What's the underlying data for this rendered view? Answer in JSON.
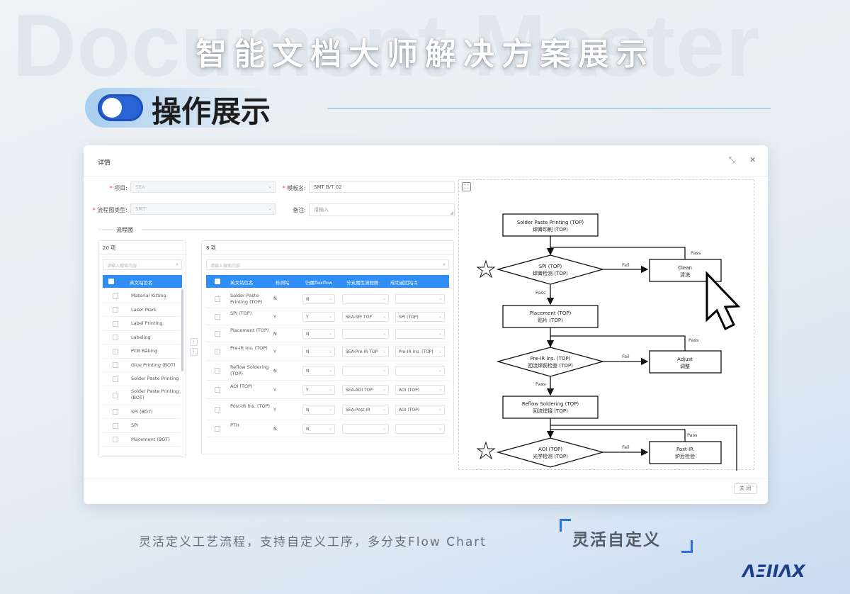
{
  "watermark": "Document Master",
  "page_title": "智能文档大师解决方案展示",
  "section": {
    "title": "操作展示"
  },
  "dialog": {
    "title": "详情",
    "form": {
      "project_label": "项目:",
      "project_value": "SEA",
      "template_label": "模板名:",
      "template_value": "SMT B/T 02",
      "flow_type_label": "流程图类型:",
      "flow_type_value": "SMT",
      "remark_label": "备注:",
      "remark_placeholder": "请输入"
    },
    "group_title": "流程图",
    "left_panel": {
      "count": "20 项",
      "search_placeholder": "请输入搜索内容",
      "header": "英文站位名",
      "items": [
        "Material Kitting",
        "Laser Mark",
        "Label Printing",
        "Labeling",
        "PCB Baking",
        "Glue Printing (BOT)",
        "Solder Paste Printing",
        "Solder Paste Printing (BOT)",
        "SPI (BOT)",
        "SPI",
        "Placement (BOT)"
      ]
    },
    "right_panel": {
      "count": "8 项",
      "search_placeholder": "请输入搜索内容",
      "columns": [
        "英文站位名",
        "检测站",
        "归属flexflow",
        "分支属性流程图",
        "成功返回站点"
      ],
      "rows": [
        {
          "name": "Solder Paste Printing (TOP)",
          "check": "N",
          "flex": "N",
          "branch": "",
          "ret": ""
        },
        {
          "name": "SPI (TOP)",
          "check": "Y",
          "flex": "Y",
          "branch": "SEA-SPI TOP",
          "ret": "SPI (TOP)"
        },
        {
          "name": "Placement (TOP)",
          "check": "N",
          "flex": "N",
          "branch": "",
          "ret": ""
        },
        {
          "name": "Pre-IR Ins. (TOP)",
          "check": "Y",
          "flex": "N",
          "branch": "SEA-Pre-IR TOP",
          "ret": "Pre-IR Ins. (TOP)"
        },
        {
          "name": "Reflow Soldering (TOP)",
          "check": "N",
          "flex": "N",
          "branch": "",
          "ret": ""
        },
        {
          "name": "AOI (TOP)",
          "check": "Y",
          "flex": "Y",
          "branch": "SEA-AOI TOP",
          "ret": "AOI (TOP)"
        },
        {
          "name": "Post-IR Ins. (TOP)",
          "check": "Y",
          "flex": "N",
          "branch": "SEA-Post-IR",
          "ret": "AOI (TOP)"
        },
        {
          "name": "PTH",
          "check": "N",
          "flex": "N",
          "branch": "",
          "ret": ""
        }
      ]
    },
    "flowchart": {
      "nodes": {
        "n1a": "Solder Paste Printing (TOP)",
        "n1b": "焊膏印刷 (TOP)",
        "n2a": "SPI (TOP)",
        "n2b": "焊膏检测 (TOP)",
        "n3a": "Clean",
        "n3b": "清洗",
        "n4a": "Placement (TOP)",
        "n4b": "贴片 (TOP)",
        "n5a": "Pre-IR Ins. (TOP)",
        "n5b": "回流焊前检查 (TOP)",
        "n6a": "Adjust",
        "n6b": "调整",
        "n7a": "Reflow Soldering (TOP)",
        "n7b": "回流焊接 (TOP)",
        "n8a": "AOI (TOP)",
        "n8b": "光学检测 (TOP)",
        "n9a": "Post-IR",
        "n9b": "炉后检验"
      },
      "labels": {
        "pass": "Pass",
        "fail": "Fail"
      }
    },
    "close_label": "关 闭"
  },
  "caption": "灵活定义工艺流程，支持自定义工序，多分支Flow Chart",
  "caption_tag": "灵活自定义",
  "logo_text": "ΛΞIIΛX",
  "colors": {
    "accent": "#2f8ef5",
    "toggle": "#2a63d6",
    "bracket": "#2e6fe0"
  }
}
